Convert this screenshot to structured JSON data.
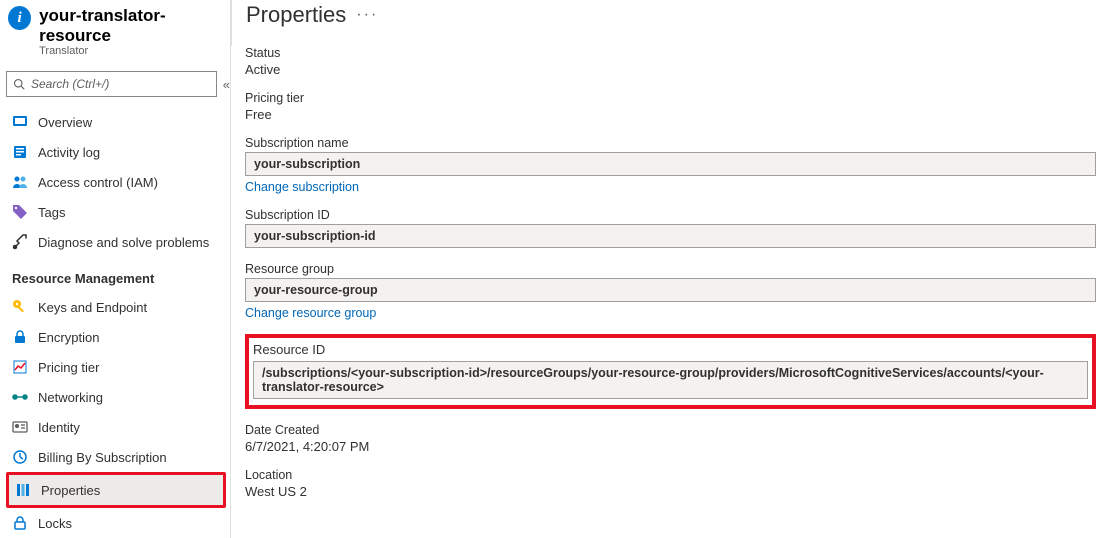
{
  "header": {
    "title": "your-translator-resource",
    "subtitle": "Translator"
  },
  "search": {
    "placeholder": "Search (Ctrl+/)"
  },
  "nav": {
    "top": [
      {
        "label": "Overview"
      },
      {
        "label": "Activity log"
      },
      {
        "label": "Access control (IAM)"
      },
      {
        "label": "Tags"
      },
      {
        "label": "Diagnose and solve problems"
      }
    ],
    "section": "Resource Management",
    "rm": [
      {
        "label": "Keys and Endpoint"
      },
      {
        "label": "Encryption"
      },
      {
        "label": "Pricing tier"
      },
      {
        "label": "Networking"
      },
      {
        "label": "Identity"
      },
      {
        "label": "Billing By Subscription"
      },
      {
        "label": "Properties"
      },
      {
        "label": "Locks"
      }
    ]
  },
  "page": {
    "title": "Properties",
    "more": "···"
  },
  "props": {
    "status_lbl": "Status",
    "status_val": "Active",
    "tier_lbl": "Pricing tier",
    "tier_val": "Free",
    "subname_lbl": "Subscription name",
    "subname_val": "your-subscription",
    "subname_link": "Change subscription",
    "subid_lbl": "Subscription ID",
    "subid_val": "your-subscription-id",
    "rg_lbl": "Resource group",
    "rg_val": "your-resource-group",
    "rg_link": "Change resource group",
    "resid_lbl": "Resource ID",
    "resid_val": "/subscriptions/<your-subscription-id>/resourceGroups/your-resource-group/providers/MicrosoftCognitiveServices/accounts/<your-translator-resource>",
    "created_lbl": "Date Created",
    "created_val": "6/7/2021, 4:20:07 PM",
    "loc_lbl": "Location",
    "loc_val": "West US 2"
  }
}
